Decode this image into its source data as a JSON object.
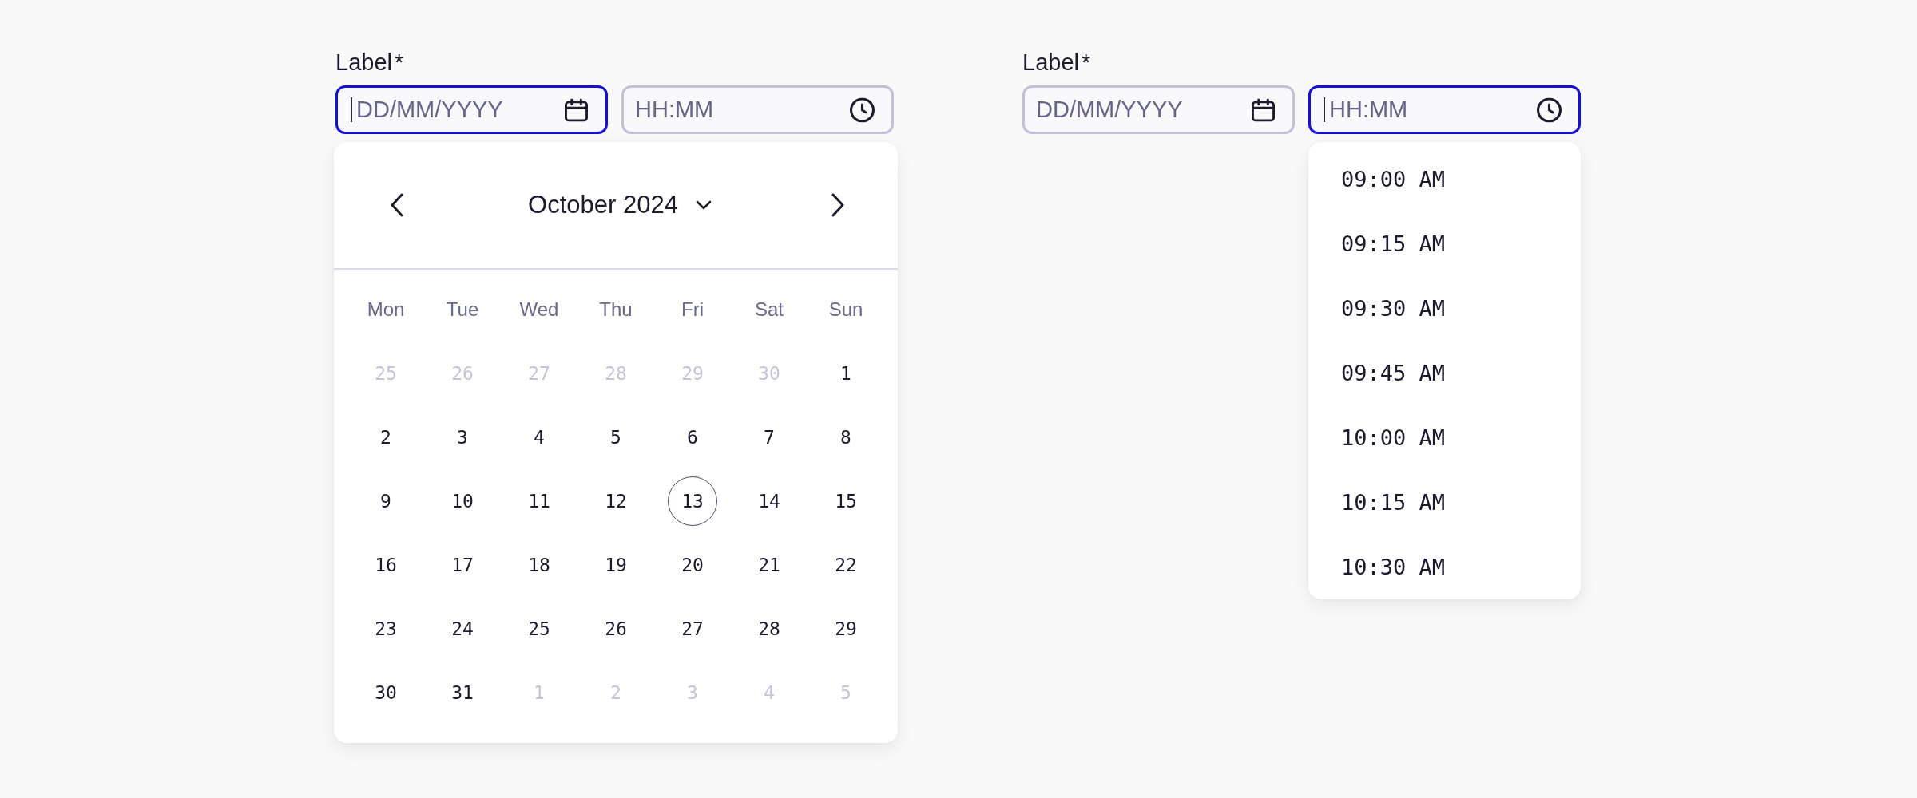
{
  "pickers": [
    {
      "label": "Label",
      "required_mark": "*",
      "fields": [
        {
          "kind": "date",
          "placeholder": "DD/MM/YYYY",
          "focused": true
        },
        {
          "kind": "time",
          "placeholder": "HH:MM",
          "focused": false
        }
      ],
      "popup": {
        "kind": "calendar",
        "month_title": "October 2024",
        "weekdays": [
          "Mon",
          "Tue",
          "Wed",
          "Thu",
          "Fri",
          "Sat",
          "Sun"
        ],
        "days": [
          {
            "text": "25",
            "outside_month": true,
            "selected": false
          },
          {
            "text": "26",
            "outside_month": true,
            "selected": false
          },
          {
            "text": "27",
            "outside_month": true,
            "selected": false
          },
          {
            "text": "28",
            "outside_month": true,
            "selected": false
          },
          {
            "text": "29",
            "outside_month": true,
            "selected": false
          },
          {
            "text": "30",
            "outside_month": true,
            "selected": false
          },
          {
            "text": "1",
            "outside_month": false,
            "selected": false
          },
          {
            "text": "2",
            "outside_month": false,
            "selected": false
          },
          {
            "text": "3",
            "outside_month": false,
            "selected": false
          },
          {
            "text": "4",
            "outside_month": false,
            "selected": false
          },
          {
            "text": "5",
            "outside_month": false,
            "selected": false
          },
          {
            "text": "6",
            "outside_month": false,
            "selected": false
          },
          {
            "text": "7",
            "outside_month": false,
            "selected": false
          },
          {
            "text": "8",
            "outside_month": false,
            "selected": false
          },
          {
            "text": "9",
            "outside_month": false,
            "selected": false
          },
          {
            "text": "10",
            "outside_month": false,
            "selected": false
          },
          {
            "text": "11",
            "outside_month": false,
            "selected": false
          },
          {
            "text": "12",
            "outside_month": false,
            "selected": false
          },
          {
            "text": "13",
            "outside_month": false,
            "selected": true
          },
          {
            "text": "14",
            "outside_month": false,
            "selected": false
          },
          {
            "text": "15",
            "outside_month": false,
            "selected": false
          },
          {
            "text": "16",
            "outside_month": false,
            "selected": false
          },
          {
            "text": "17",
            "outside_month": false,
            "selected": false
          },
          {
            "text": "18",
            "outside_month": false,
            "selected": false
          },
          {
            "text": "19",
            "outside_month": false,
            "selected": false
          },
          {
            "text": "20",
            "outside_month": false,
            "selected": false
          },
          {
            "text": "21",
            "outside_month": false,
            "selected": false
          },
          {
            "text": "22",
            "outside_month": false,
            "selected": false
          },
          {
            "text": "23",
            "outside_month": false,
            "selected": false
          },
          {
            "text": "24",
            "outside_month": false,
            "selected": false
          },
          {
            "text": "25",
            "outside_month": false,
            "selected": false
          },
          {
            "text": "26",
            "outside_month": false,
            "selected": false
          },
          {
            "text": "27",
            "outside_month": false,
            "selected": false
          },
          {
            "text": "28",
            "outside_month": false,
            "selected": false
          },
          {
            "text": "29",
            "outside_month": false,
            "selected": false
          },
          {
            "text": "30",
            "outside_month": false,
            "selected": false
          },
          {
            "text": "31",
            "outside_month": false,
            "selected": false
          },
          {
            "text": "1",
            "outside_month": true,
            "selected": false
          },
          {
            "text": "2",
            "outside_month": true,
            "selected": false
          },
          {
            "text": "3",
            "outside_month": true,
            "selected": false
          },
          {
            "text": "4",
            "outside_month": true,
            "selected": false
          },
          {
            "text": "5",
            "outside_month": true,
            "selected": false
          }
        ]
      }
    },
    {
      "label": "Label",
      "required_mark": "*",
      "fields": [
        {
          "kind": "date",
          "placeholder": "DD/MM/YYYY",
          "focused": false
        },
        {
          "kind": "time",
          "placeholder": "HH:MM",
          "focused": true
        }
      ],
      "popup": {
        "kind": "time_list",
        "options": [
          {
            "text": "09:00 AM",
            "selected": false
          },
          {
            "text": "09:15 AM",
            "selected": false
          },
          {
            "text": "09:30 AM",
            "selected": false
          },
          {
            "text": "09:45 AM",
            "selected": false
          },
          {
            "text": "10:00 AM",
            "selected": false
          },
          {
            "text": "10:15 AM",
            "selected": false
          },
          {
            "text": "10:30 AM",
            "selected": false
          }
        ]
      }
    }
  ]
}
